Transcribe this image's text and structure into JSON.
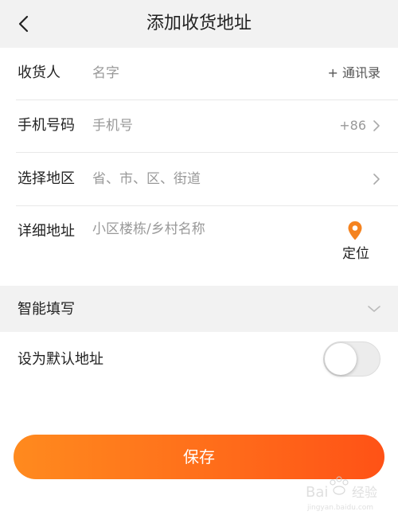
{
  "header": {
    "title": "添加收货地址"
  },
  "form": {
    "consignee": {
      "label": "收货人",
      "placeholder": "名字",
      "action": "+ 通讯录"
    },
    "phone": {
      "label": "手机号码",
      "placeholder": "手机号",
      "country_code": "+86"
    },
    "region": {
      "label": "选择地区",
      "placeholder": "省、市、区、街道"
    },
    "address": {
      "label": "详细地址",
      "placeholder": "小区楼栋/乡村名称",
      "locate_label": "定位"
    }
  },
  "smart_fill": {
    "label": "智能填写"
  },
  "default_address": {
    "label": "设为默认地址",
    "enabled": false
  },
  "save_button": {
    "label": "保存"
  },
  "colors": {
    "accent": "#ff6a1a",
    "locate_pin": "#f5831f"
  }
}
